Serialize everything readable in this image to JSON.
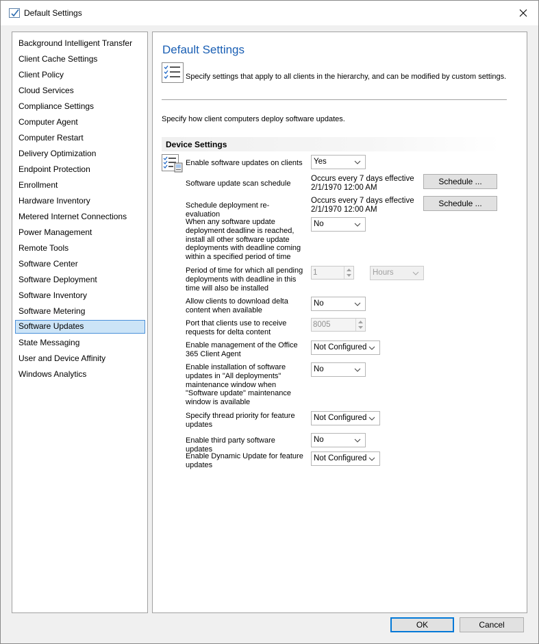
{
  "window": {
    "title": "Default Settings"
  },
  "nav": {
    "items": [
      "Background Intelligent Transfer",
      "Client Cache Settings",
      "Client Policy",
      "Cloud Services",
      "Compliance Settings",
      "Computer Agent",
      "Computer Restart",
      "Delivery Optimization",
      "Endpoint Protection",
      "Enrollment",
      "Hardware Inventory",
      "Metered Internet Connections",
      "Power Management",
      "Remote Tools",
      "Software Center",
      "Software Deployment",
      "Software Inventory",
      "Software Metering",
      "Software Updates",
      "State Messaging",
      "User and Device Affinity",
      "Windows Analytics"
    ],
    "selected": "Software Updates"
  },
  "main": {
    "title": "Default Settings",
    "description": "Specify settings that apply to all clients in the hierarchy, and can be modified by custom settings.",
    "intro": "Specify how client computers deploy software updates.",
    "section_title": "Device Settings",
    "settings": {
      "enable_updates": {
        "label": "Enable software updates on clients",
        "value": "Yes"
      },
      "scan_schedule": {
        "label": "Software update scan schedule",
        "value_line1": "Occurs every 7 days effective",
        "value_line2": "2/1/1970 12:00 AM",
        "button": "Schedule ..."
      },
      "reevaluation": {
        "label": "Schedule deployment re-evaluation",
        "value_line1": "Occurs every 7 days effective",
        "value_line2": "2/1/1970 12:00 AM",
        "button": "Schedule ..."
      },
      "deadline": {
        "label": "When any software update deployment deadline is reached, install all other software update deployments with deadline coming within a specified period of time",
        "value": "No"
      },
      "period": {
        "label": "Period of time for which all pending deployments with deadline in this time will also be installed",
        "value": "1",
        "unit": "Hours"
      },
      "delta": {
        "label": "Allow clients to download delta content when available",
        "value": "No"
      },
      "delta_port": {
        "label": "Port that clients use to receive requests for delta content",
        "value": "8005"
      },
      "office365": {
        "label": "Enable management of the Office 365 Client Agent",
        "value": "Not Configured"
      },
      "maintenance_window": {
        "label": "Enable installation of software updates in \"All deployments\" maintenance window when \"Software update\" maintenance window is available",
        "value": "No"
      },
      "thread_priority": {
        "label": "Specify thread priority for feature updates",
        "value": "Not Configured"
      },
      "third_party": {
        "label": "Enable third party software updates",
        "value": "No"
      },
      "dynamic_update": {
        "label": "Enable Dynamic Update for feature updates",
        "value": "Not Configured"
      }
    }
  },
  "footer": {
    "ok": "OK",
    "cancel": "Cancel"
  },
  "colors": {
    "title_blue": "#1a5fb4",
    "selection": "#cce4f7",
    "accent": "#0078d7"
  }
}
